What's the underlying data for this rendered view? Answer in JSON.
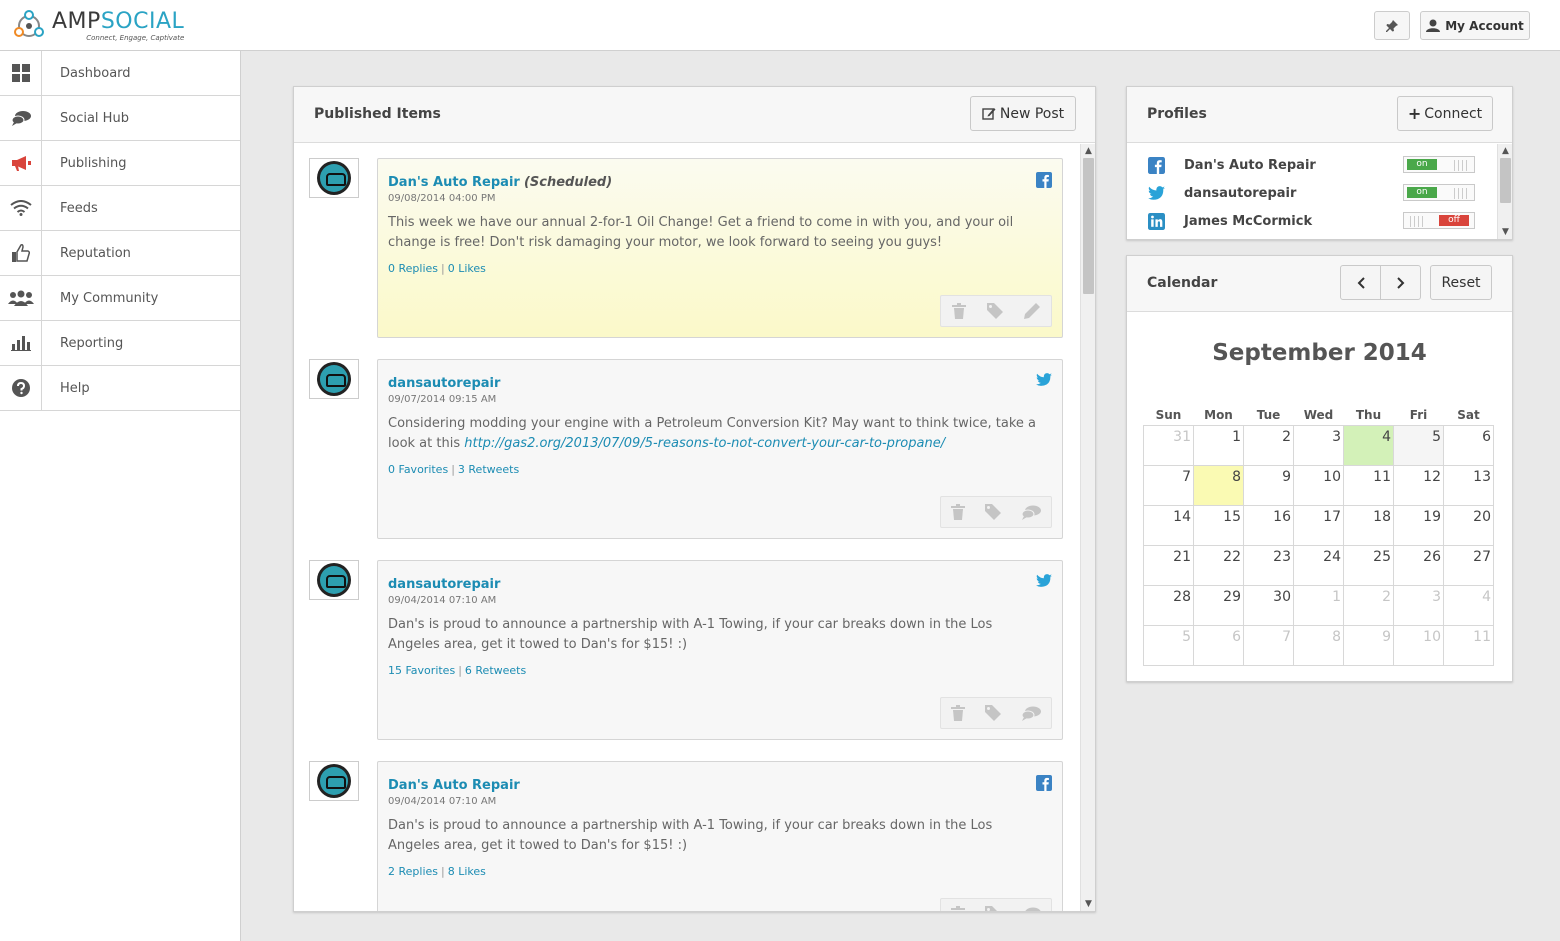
{
  "app": {
    "logo_amp": "AMP",
    "logo_social": "SOCIAL",
    "tagline": "Connect, Engage, Captivate",
    "account_label": "My Account"
  },
  "sidebar": {
    "items": [
      {
        "label": "Dashboard",
        "icon": "dashboard-grid-icon"
      },
      {
        "label": "Social Hub",
        "icon": "chat-bubbles-icon"
      },
      {
        "label": "Publishing",
        "icon": "megaphone-icon"
      },
      {
        "label": "Feeds",
        "icon": "wifi-icon"
      },
      {
        "label": "Reputation",
        "icon": "thumbs-up-icon"
      },
      {
        "label": "My Community",
        "icon": "users-icon"
      },
      {
        "label": "Reporting",
        "icon": "bar-chart-icon"
      },
      {
        "label": "Help",
        "icon": "question-icon"
      }
    ]
  },
  "published": {
    "title": "Published Items",
    "new_post_label": "New Post",
    "posts": [
      {
        "author": "Dan's Auto Repair",
        "status": "(Scheduled)",
        "date": "09/08/2014 04:00 PM",
        "network": "facebook",
        "text": "This week we have our annual 2-for-1 Oil Change! Get a friend to come in with you, and your oil change is free! Don't risk damaging your motor, we look forward to seeing you guys!",
        "link": "",
        "stat1": "0 Replies",
        "stat2": "0 Likes"
      },
      {
        "author": "dansautorepair",
        "status": "",
        "date": "09/07/2014 09:15 AM",
        "network": "twitter",
        "text": "Considering modding your engine with a Petroleum Conversion Kit? May want to think twice, take a look at this",
        "link": "http://gas2.org/2013/07/09/5-reasons-to-not-convert-your-car-to-propane/",
        "stat1": "0 Favorites",
        "stat2": "3 Retweets"
      },
      {
        "author": "dansautorepair",
        "status": "",
        "date": "09/04/2014 07:10 AM",
        "network": "twitter",
        "text": "Dan's is proud to announce a partnership with A-1 Towing, if your car breaks down in the Los Angeles area, get it towed to Dan's for $15! :)",
        "link": "",
        "stat1": "15 Favorites",
        "stat2": "6 Retweets"
      },
      {
        "author": "Dan's Auto Repair",
        "status": "",
        "date": "09/04/2014 07:10 AM",
        "network": "facebook",
        "text": "Dan's is proud to announce a partnership with A-1 Towing, if your car breaks down in the Los Angeles area, get it towed to Dan's for $15! :)",
        "link": "",
        "stat1": "2 Replies",
        "stat2": "8 Likes"
      }
    ]
  },
  "profiles": {
    "title": "Profiles",
    "connect_label": "Connect",
    "items": [
      {
        "name": "Dan's Auto Repair",
        "network": "facebook",
        "state": "on"
      },
      {
        "name": "dansautorepair",
        "network": "twitter",
        "state": "on"
      },
      {
        "name": "James McCormick",
        "network": "linkedin",
        "state": "off"
      }
    ]
  },
  "calendar": {
    "title": "Calendar",
    "reset_label": "Reset",
    "month": "September 2014",
    "weekdays": [
      "Sun",
      "Mon",
      "Tue",
      "Wed",
      "Thu",
      "Fri",
      "Sat"
    ],
    "weeks": [
      [
        "31",
        "1",
        "2",
        "3",
        "4",
        "5",
        "6"
      ],
      [
        "7",
        "8",
        "9",
        "10",
        "11",
        "12",
        "13"
      ],
      [
        "14",
        "15",
        "16",
        "17",
        "18",
        "19",
        "20"
      ],
      [
        "21",
        "22",
        "23",
        "24",
        "25",
        "26",
        "27"
      ],
      [
        "28",
        "29",
        "30",
        "1",
        "2",
        "3",
        "4"
      ],
      [
        "5",
        "6",
        "7",
        "8",
        "9",
        "10",
        "11"
      ]
    ],
    "today": "4",
    "selected": "8",
    "colors": {
      "today": "#d3f1b8",
      "selected": "#fafab3"
    }
  },
  "colors": {
    "accent": "#1c8cb3",
    "brand": "#2aa3c4",
    "facebook": "#3b83c4",
    "twitter": "#2aa3d8",
    "linkedin": "#2b8fc4"
  }
}
